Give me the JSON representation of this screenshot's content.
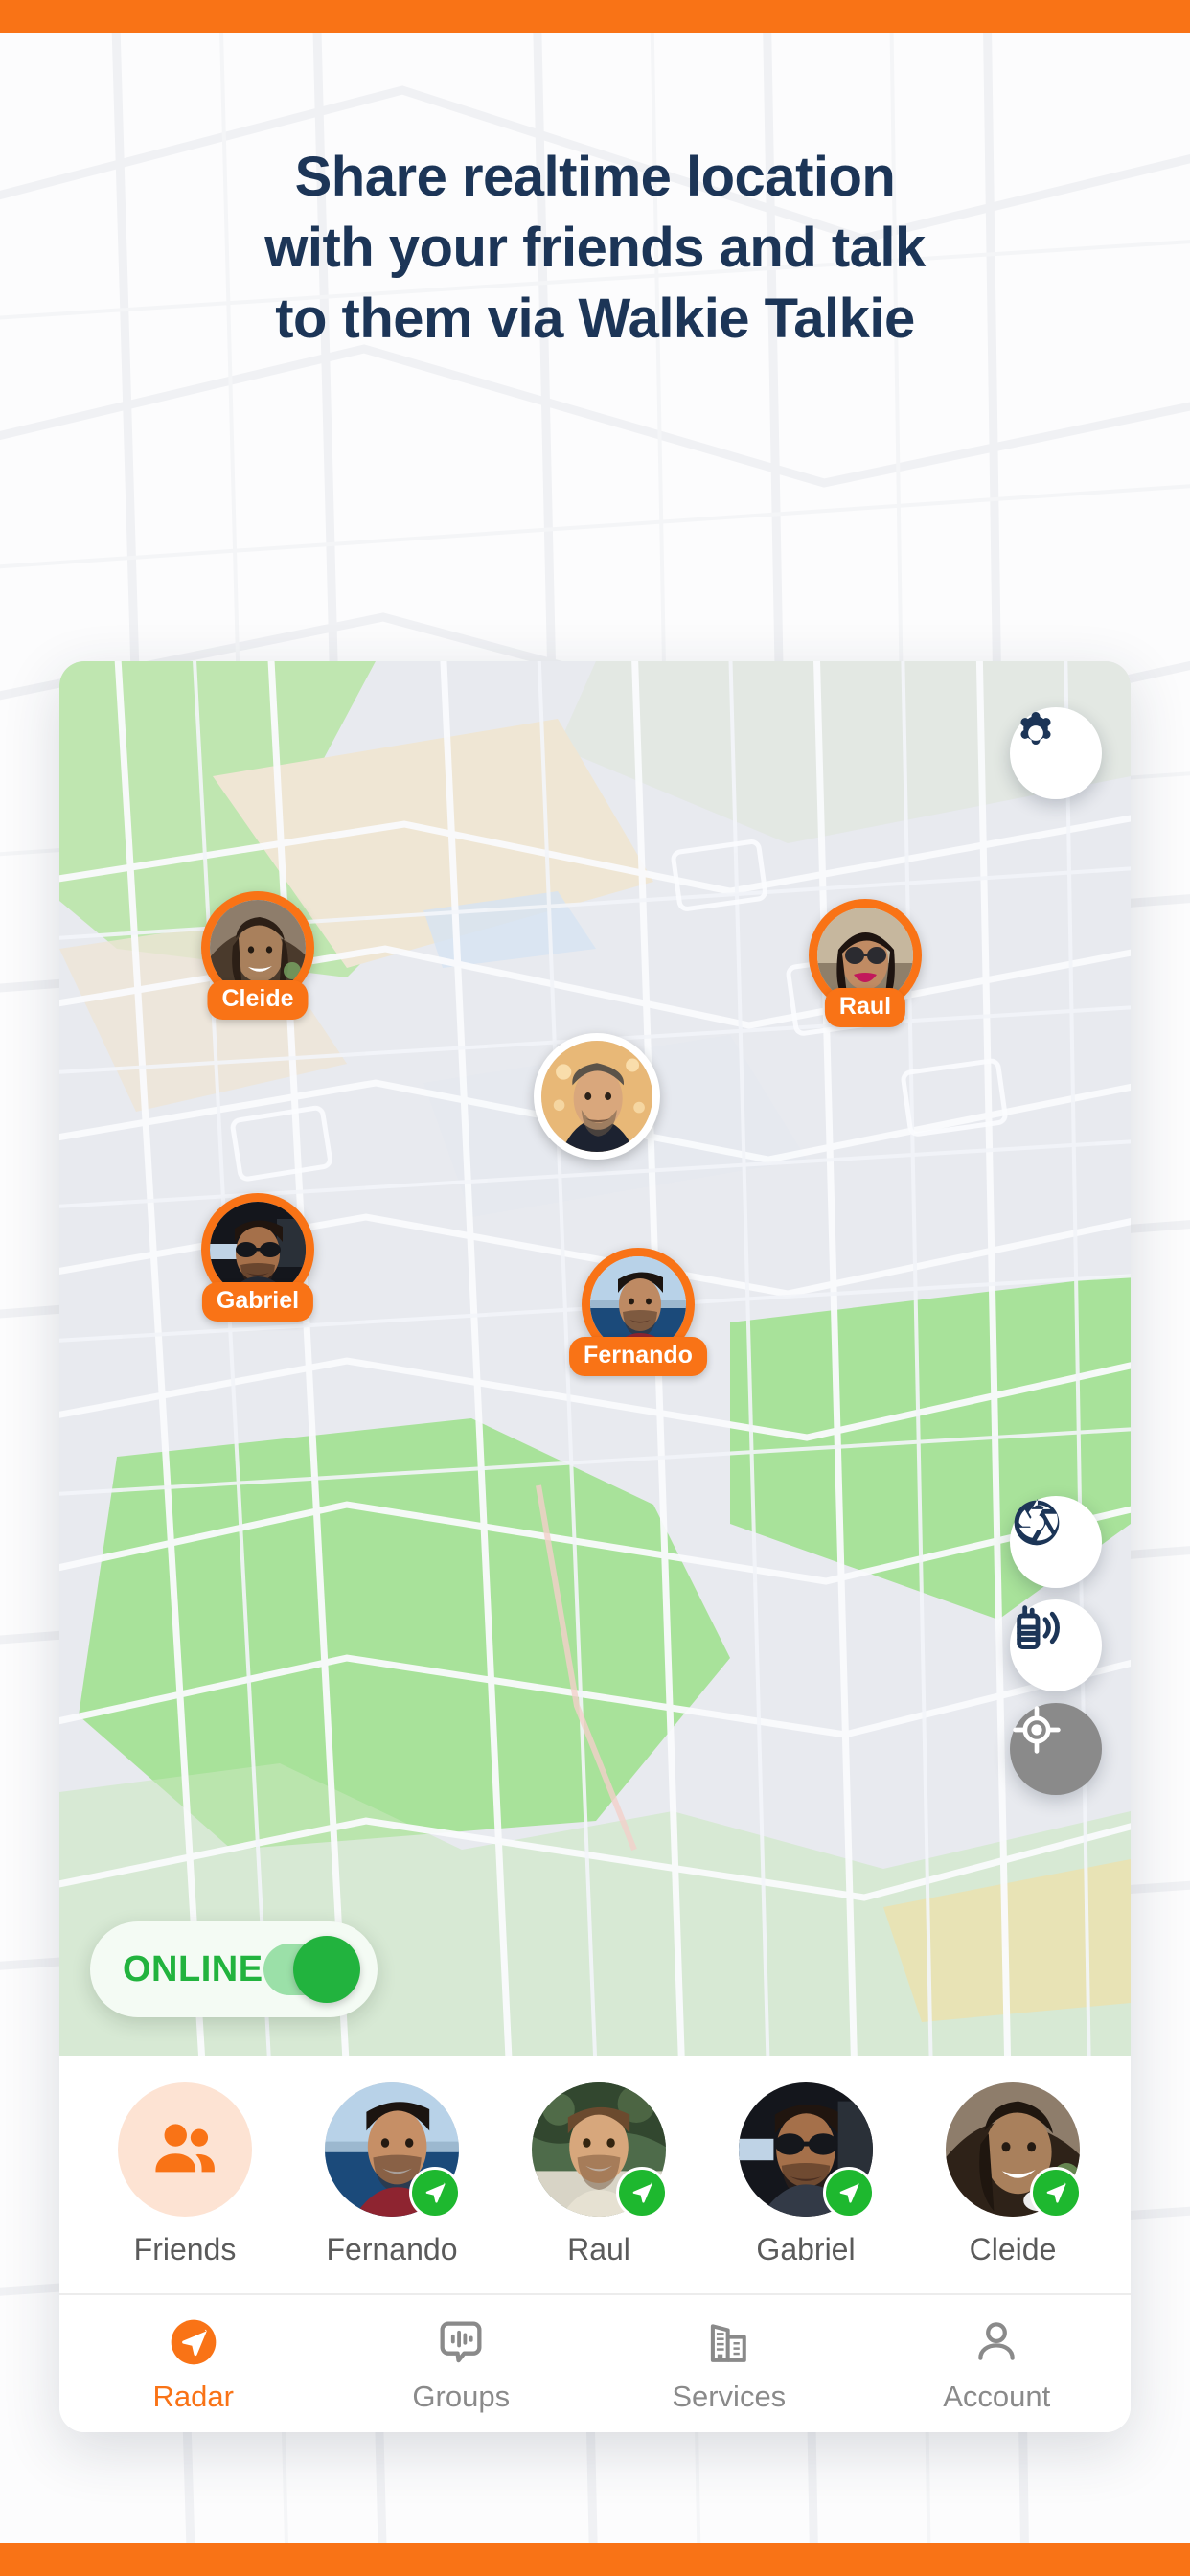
{
  "brand": {
    "accent_orange": "#F97316",
    "navy": "#1C3557",
    "green": "#22B33E",
    "grey": "#8A8A8A"
  },
  "headline": {
    "line1": "Share realtime location",
    "line2": "with your friends and talk",
    "line3": "to them via Walkie Talkie"
  },
  "map": {
    "settings_icon": "gear-icon",
    "camera_icon": "aperture-icon",
    "walkie_icon": "walkie-talkie-icon",
    "locate_icon": "my-location-icon",
    "markers": [
      {
        "name": "Cleide",
        "icon": "map-marker-avatar"
      },
      {
        "name": "Raul",
        "icon": "map-marker-avatar"
      },
      {
        "name": "Gabriel",
        "icon": "map-marker-avatar"
      },
      {
        "name": "Fernando",
        "icon": "map-marker-avatar"
      }
    ],
    "self_marker": {
      "name": "",
      "icon": "self-avatar"
    },
    "status": {
      "label": "ONLINE",
      "toggle_on": true
    }
  },
  "friends": [
    {
      "name": "Friends",
      "icon": "people-group-icon",
      "online": false,
      "is_group": true
    },
    {
      "name": "Fernando",
      "icon": "avatar",
      "online": true,
      "is_group": false
    },
    {
      "name": "Raul",
      "icon": "avatar",
      "online": true,
      "is_group": false
    },
    {
      "name": "Gabriel",
      "icon": "avatar",
      "online": true,
      "is_group": false
    },
    {
      "name": "Cleide",
      "icon": "avatar",
      "online": true,
      "is_group": false
    }
  ],
  "nav": [
    {
      "label": "Radar",
      "icon": "radar-navigation-icon",
      "active": true
    },
    {
      "label": "Groups",
      "icon": "walkie-chat-icon",
      "active": false
    },
    {
      "label": "Services",
      "icon": "buildings-icon",
      "active": false
    },
    {
      "label": "Account",
      "icon": "person-icon",
      "active": false
    }
  ]
}
